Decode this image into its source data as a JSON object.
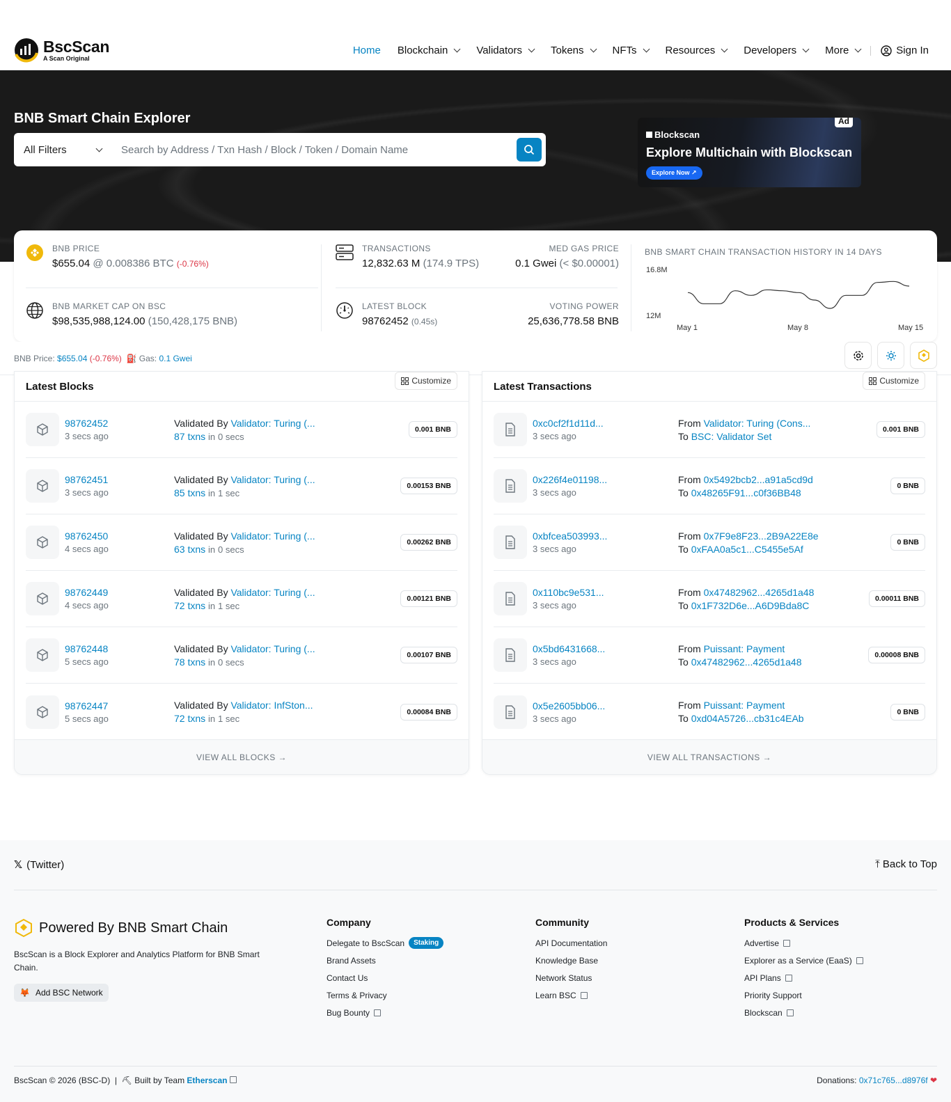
{
  "header": {
    "logo_name": "BscScan",
    "logo_tagline": "A Scan Original",
    "nav": [
      {
        "label": "Home",
        "active": true
      },
      {
        "label": "Blockchain"
      },
      {
        "label": "Validators"
      },
      {
        "label": "Tokens"
      },
      {
        "label": "NFTs"
      },
      {
        "label": "Resources"
      },
      {
        "label": "Developers"
      },
      {
        "label": "More"
      }
    ],
    "sign_in": "Sign In"
  },
  "hero": {
    "title": "BNB Smart Chain Explorer",
    "filter_value": "All Filters",
    "search_placeholder": "Search by Address / Txn Hash / Block / Token / Domain Name",
    "ad": {
      "badge": "Ad",
      "brand": "Blockscan",
      "title": "Explore Multichain with Blockscan",
      "button": "Explore Now ↗"
    }
  },
  "stats": {
    "bnb_price_label": "BNB PRICE",
    "bnb_price": "$655.04",
    "bnb_btc": "@ 0.008386 BTC",
    "bnb_change": "(-0.76%)",
    "market_cap_label": "BNB MARKET CAP ON BSC",
    "market_cap": "$98,535,988,124.00",
    "market_cap_bnb": "(150,428,175 BNB)",
    "transactions_label": "TRANSACTIONS",
    "transactions": "12,832.63 M",
    "tps": "(174.9 TPS)",
    "gas_label": "MED GAS PRICE",
    "gas": "0.1 Gwei",
    "gas_usd": "(< $0.00001)",
    "latest_block_label": "LATEST BLOCK",
    "latest_block": "98762452",
    "latest_block_time": "(0.45s)",
    "voting_power_label": "VOTING POWER",
    "voting_power": "25,636,778.58 BNB"
  },
  "chart_data": {
    "type": "line",
    "title": "BNB SMART CHAIN TRANSACTION HISTORY IN 14 DAYS",
    "xlabel": "",
    "ylabel": "",
    "ytick_labels": [
      "16.8M",
      "12M"
    ],
    "xtick_labels": [
      "May 1",
      "May 8",
      "May 15"
    ],
    "ylim": [
      12,
      16.8
    ],
    "x": [
      "May 1",
      "May 2",
      "May 3",
      "May 4",
      "May 5",
      "May 6",
      "May 7",
      "May 8",
      "May 9",
      "May 10",
      "May 11",
      "May 12",
      "May 13",
      "May 14",
      "May 15"
    ],
    "series": [
      {
        "values": [
          14.3,
          13.1,
          13.1,
          14.5,
          14.0,
          14.6,
          14.5,
          14.3,
          13.5,
          12.6,
          14.0,
          14.0,
          15.4,
          15.5,
          15.0
        ]
      }
    ],
    "grid": false
  },
  "gasbar": {
    "price_label": "BNB Price:",
    "price": "$655.04",
    "change": "(-0.76%)",
    "gas_label": "Gas:",
    "gas": "0.1 Gwei"
  },
  "blocks": {
    "title": "Latest Blocks",
    "customize": "Customize",
    "validated_by": "Validated By",
    "in_label": "in",
    "rows": [
      {
        "num": "98762452",
        "age": "3 secs ago",
        "validator": "Validator: Turing (...",
        "txns": "87 txns",
        "time": "0 secs",
        "reward": "0.001 BNB"
      },
      {
        "num": "98762451",
        "age": "3 secs ago",
        "validator": "Validator: Turing (...",
        "txns": "85 txns",
        "time": "1 sec",
        "reward": "0.00153 BNB"
      },
      {
        "num": "98762450",
        "age": "4 secs ago",
        "validator": "Validator: Turing (...",
        "txns": "63 txns",
        "time": "0 secs",
        "reward": "0.00262 BNB"
      },
      {
        "num": "98762449",
        "age": "4 secs ago",
        "validator": "Validator: Turing (...",
        "txns": "72 txns",
        "time": "1 sec",
        "reward": "0.00121 BNB"
      },
      {
        "num": "98762448",
        "age": "5 secs ago",
        "validator": "Validator: Turing (...",
        "txns": "78 txns",
        "time": "0 secs",
        "reward": "0.00107 BNB"
      },
      {
        "num": "98762447",
        "age": "5 secs ago",
        "validator": "Validator: InfSton...",
        "txns": "72 txns",
        "time": "1 sec",
        "reward": "0.00084 BNB"
      }
    ],
    "view_all": "VIEW ALL BLOCKS →"
  },
  "transactions": {
    "title": "Latest Transactions",
    "customize": "Customize",
    "from_label": "From",
    "to_label": "To",
    "rows": [
      {
        "hash": "0xc0cf2f1d11d...",
        "age": "3 secs ago",
        "from": "Validator: Turing (Cons...",
        "to": "BSC: Validator Set",
        "value": "0.001 BNB"
      },
      {
        "hash": "0x226f4e01198...",
        "age": "3 secs ago",
        "from": "0x5492bcb2...a91a5cd9d",
        "to": "0x48265F91...c0f36BB48",
        "value": "0 BNB"
      },
      {
        "hash": "0xbfcea503993...",
        "age": "3 secs ago",
        "from": "0x7F9e8F23...2B9A22E8e",
        "to": "0xFAA0a5c1...C5455e5Af",
        "value": "0 BNB"
      },
      {
        "hash": "0x110bc9e531...",
        "age": "3 secs ago",
        "from": "0x47482962...4265d1a48",
        "to": "0x1F732D6e...A6D9Bda8C",
        "value": "0.00011 BNB"
      },
      {
        "hash": "0x5bd6431668...",
        "age": "3 secs ago",
        "from": "Puissant: Payment",
        "to": "0x47482962...4265d1a48",
        "value": "0.00008 BNB"
      },
      {
        "hash": "0x5e2605bb06...",
        "age": "3 secs ago",
        "from": "Puissant: Payment",
        "to": "0xd04A5726...cb31c4EAb",
        "value": "0 BNB"
      }
    ],
    "view_all": "VIEW ALL TRANSACTIONS →"
  },
  "footer": {
    "twitter": "(Twitter)",
    "back_to_top": "Back to Top",
    "powered_by": "Powered By BNB Smart Chain",
    "description": "BscScan is a Block Explorer and Analytics Platform for BNB Smart Chain.",
    "add_network": "Add BSC Network",
    "company": {
      "title": "Company",
      "items": [
        "Delegate to BscScan",
        "Brand Assets",
        "Contact Us",
        "Terms & Privacy",
        "Bug Bounty"
      ],
      "staking": "Staking"
    },
    "community": {
      "title": "Community",
      "items": [
        "API Documentation",
        "Knowledge Base",
        "Network Status",
        "Learn BSC"
      ]
    },
    "products": {
      "title": "Products & Services",
      "items": [
        "Advertise",
        "Explorer as a Service (EaaS)",
        "API Plans",
        "Priority Support",
        "Blockscan"
      ]
    },
    "copyright": "BscScan © 2026 (BSC-D)",
    "built_by": "Built by Team",
    "etherscan": "Etherscan",
    "donations_label": "Donations:",
    "donations": "0x71c765...d8976f"
  },
  "colors": {
    "accent": "#0784c3",
    "bnb": "#f0b90b",
    "negative": "#dc3545",
    "hero_bg": "#1a1a1a"
  }
}
